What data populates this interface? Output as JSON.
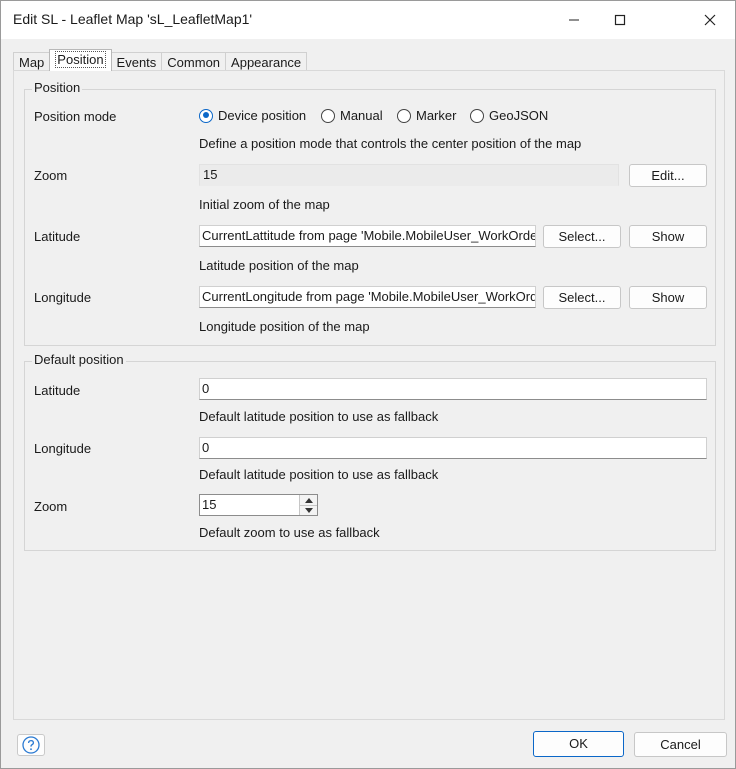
{
  "window": {
    "title": "Edit SL - Leaflet Map 'sL_LeafletMap1'"
  },
  "tabs": [
    {
      "label": "Map",
      "active": false
    },
    {
      "label": "Position",
      "active": true
    },
    {
      "label": "Events",
      "active": false
    },
    {
      "label": "Common",
      "active": false
    },
    {
      "label": "Appearance",
      "active": false
    }
  ],
  "position_group": {
    "title": "Position",
    "mode": {
      "label": "Position mode",
      "options": [
        "Device position",
        "Manual",
        "Marker",
        "GeoJSON"
      ],
      "selected": "Device position",
      "hint": "Define a position mode that controls the center position of the map"
    },
    "zoom": {
      "label": "Zoom",
      "value": "15",
      "edit_label": "Edit...",
      "hint": "Initial zoom of the map"
    },
    "latitude": {
      "label": "Latitude",
      "value": "CurrentLattitude from page 'Mobile.MobileUser_WorkOrder",
      "select_label": "Select...",
      "show_label": "Show",
      "hint": "Latitude position of the map"
    },
    "longitude": {
      "label": "Longitude",
      "value": "CurrentLongitude from page 'Mobile.MobileUser_WorkOrder",
      "select_label": "Select...",
      "show_label": "Show",
      "hint": "Longitude position of the map"
    }
  },
  "default_group": {
    "title": "Default position",
    "latitude": {
      "label": "Latitude",
      "value": "0",
      "hint": "Default latitude position to use as fallback"
    },
    "longitude": {
      "label": "Longitude",
      "value": "0",
      "hint": "Default latitude position to use as fallback"
    },
    "zoom": {
      "label": "Zoom",
      "value": "15",
      "hint": "Default zoom to use as fallback"
    }
  },
  "footer": {
    "ok_label": "OK",
    "cancel_label": "Cancel"
  },
  "colors": {
    "accent": "#0b67c8",
    "panel": "#f0f0f0",
    "titlebar": "#ffffff"
  }
}
